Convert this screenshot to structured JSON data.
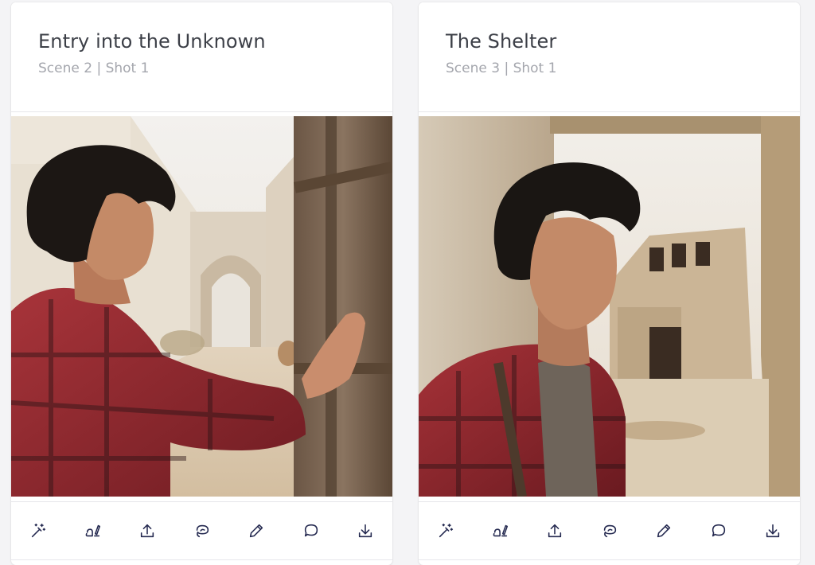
{
  "cards": [
    {
      "title": "Entry into the Unknown",
      "subtitle": "Scene 2 | Shot 1",
      "image_alt": "Young man with curly dark hair in a red plaid shirt pushing open a weathered wooden door onto a sunlit desert alley"
    },
    {
      "title": "The Shelter",
      "subtitle": "Scene 3 | Shot 1",
      "image_alt": "Young man with curly dark hair in a red plaid shirt standing in a doorway in front of ruined adobe buildings"
    }
  ],
  "toolbar_actions": [
    {
      "name": "magic-wand-icon",
      "label": "Enhance"
    },
    {
      "name": "edit-shot-icon",
      "label": "Edit"
    },
    {
      "name": "upload-icon",
      "label": "Upload"
    },
    {
      "name": "lasso-icon",
      "label": "Select"
    },
    {
      "name": "pencil-icon",
      "label": "Draw"
    },
    {
      "name": "comment-icon",
      "label": "Comment"
    },
    {
      "name": "download-icon",
      "label": "Download"
    }
  ],
  "colors": {
    "icon": "#23284f",
    "title": "#3c3f47",
    "subtitle": "#a4a6ad",
    "shirt_red": "#9b2a2d",
    "background": "#f4f4f6"
  }
}
